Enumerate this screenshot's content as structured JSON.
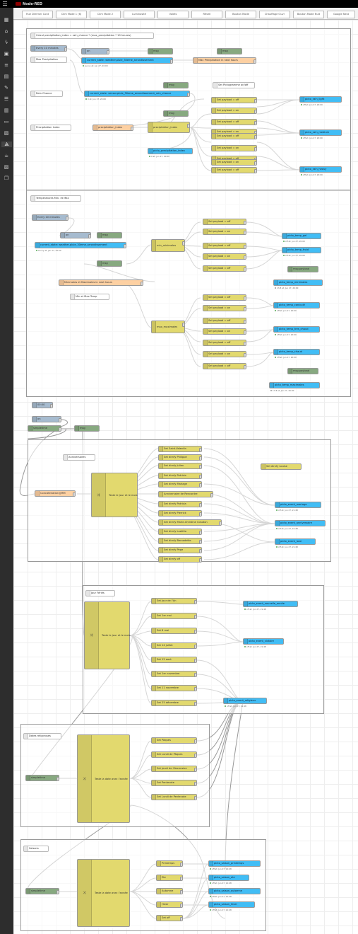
{
  "app": {
    "title": "Node-RED"
  },
  "tabs": [
    "Hue Dimmer Cont",
    "Clim Mode 1 (6)",
    "Clim Mode 2",
    "Luminosité",
    "Volets",
    "Réveil",
    "Bouton Mode",
    "Chauffage Ouvr",
    "Bouton Mode Nuit",
    "Google Nest"
  ],
  "sidebar": {
    "icons": [
      "grid-icon",
      "home-icon",
      "bolt-icon",
      "device-icon",
      "list-icon",
      "box-icon",
      "wrench-icon",
      "clipboard-icon",
      "calendar-icon",
      "window-icon",
      "chart-icon",
      "flow-icon",
      "cup-icon",
      "image-icon",
      "copy-icon"
    ]
  },
  "group1": {
    "comments": {
      "calc": "Calcul precipitation_index = rain_chance * (max_precipitation * 10 heures)",
      "max_precip": "Max Precipitation",
      "rain_chance": "Rain Chance",
      "precip_index": "Precipitation Index",
      "set_picto": "Set Pictogramme on/off"
    },
    "inject": "Every 10 minutes",
    "inject_on": "on",
    "debug_msg1": "msg",
    "debug_msg2": "msg",
    "debug_msg3": "msg",
    "debug_msg4": "msg",
    "ha_state1": "current_state: weather.pluie_30eme_arrondissement",
    "ha_state1_status": "sunny at: Jun 27, 20:00",
    "ha_state2": "current_state: sensor.pluie_30eme_arrondissement_rain_chance",
    "ha_state2_status": "0 at: Jun 27, 20:00",
    "func_max": "Max Precipitation in next hours",
    "func_index": "precipitation_index",
    "switch_index": "precipitation_index",
    "ha_index": "picto_precipitation_index",
    "ha_index_status": "0 at: Jun 27, 20:00",
    "changes": [
      "Set payload = off",
      "Set payload = on",
      "Set payload = off",
      "Set payload = on",
      "Set payload = off",
      "Set payload = on",
      "Set payload = off",
      "Set payload = on",
      "Set payload = off"
    ],
    "outputs": [
      {
        "label": "picto_rain_light",
        "status": "off at: Jun 27, 20:00"
      },
      {
        "label": "picto_rain_medium",
        "status": "off at: Jun 27, 20:00"
      },
      {
        "label": "picto_rain_heavy",
        "status": "off at: Jun 27, 20:00"
      }
    ]
  },
  "group2": {
    "comment_title": "Temperatures Min. et Max",
    "comment_minmax": "Min et Max Temp",
    "inject": "Every 10 minutes",
    "inject_on": "on",
    "debug_msg1": "msg",
    "debug_msg2": "msg",
    "debug_payload1": "msg.payload",
    "debug_payload2": "msg.payload",
    "ha_state": "current_state: weather.pluie_30eme_arrondissement",
    "ha_state_status": "sunny at: Jun 27, 20:00",
    "func": "Minimales et Maximales in next hours",
    "switch_min": "min_minimales",
    "switch_max": "max_maximales",
    "changes_min": [
      "Set payload = off",
      "Set payload = on",
      "Set payload = off",
      "Set payload = on",
      "Set payload = off"
    ],
    "changes_max": [
      "Set payload = off",
      "Set payload = on",
      "Set payload = off",
      "Set payload = on",
      "Set payload = off",
      "Set payload = on",
      "Set payload = off"
    ],
    "outputs": [
      {
        "label": "picto_temp_gel",
        "status": "off at: Jun 27, 20:00"
      },
      {
        "label": "picto_temp_froid",
        "status": "off at: Jun 27, 20:00"
      },
      {
        "label": "picto_temp_minimales",
        "status": "13.8 at: Jun 27, 20:00"
      },
      {
        "label": "picto_temp_caniculé",
        "status": "off at: Jun 27, 20:00"
      },
      {
        "label": "picto_temp_tres_chaud",
        "status": "off at: Jun 27, 20:00"
      },
      {
        "label": "picto_temp_chaud",
        "status": "off at: Jun 27, 20:00"
      },
      {
        "label": "picto_temp_maximales",
        "status": "17.8 at: Jun 27, 20:00"
      }
    ]
  },
  "standalone": {
    "inject_time": "00:00",
    "inject_on": "on",
    "simpletime": "simpletime",
    "debug_msg": "msg"
  },
  "group3": {
    "comment": "Anniversaires",
    "func": "Concatenation JJMM",
    "switch": "Teste le jour et le mois",
    "changes": [
      "Set Saint-Valentin",
      "Set dirnfy Philippe",
      "Set dirnfy Julien",
      "Set dirnfy Patricia",
      "Set dirnfy Mariage",
      "Anniversaire de Rencontre",
      "Set dirnfy Patricia",
      "Set dirnfy Pierrick",
      "Set dirnfy Marie-Christine Claudon",
      "Set dirnfy Laetitia",
      "Set dirnfy Bernadette",
      "Set dirnfy Pepe",
      "Set dirnfy off"
    ],
    "change_right": "Set dirnfy Louise",
    "outputs": [
      {
        "label": "picto_event_mariage",
        "status": "off at: Jun 27, 21:48"
      },
      {
        "label": "picto_event_anniversaire",
        "status": "off at: Jun 27, 21:48"
      },
      {
        "label": "picto_event_love",
        "status": "off at: Jun 27, 21:48"
      }
    ]
  },
  "group4": {
    "comment": "Jour Fériés",
    "switch": "Teste le jour et le mois",
    "changes": [
      "Set Jour de l'An",
      "Set 1er mai",
      "Set 8 mai",
      "Set 14 juillet",
      "Set 15 aout",
      "Set 1er novembre",
      "Set 11 novembre",
      "Set 25 décembre"
    ],
    "outputs": [
      {
        "label": "picto_event_nouvelle_année",
        "status": "off at: Jun 27, 21:48"
      },
      {
        "label": "picto_event_victoire",
        "status": "off at: Jun 27, 21:48"
      },
      {
        "label": "picto_event_religieux",
        "status": "off at: Jun 27, 21:48"
      }
    ]
  },
  "group5": {
    "comment": "Dates religieuses",
    "simpletime": "simpletime",
    "switch": "Teste la date avec l'année",
    "changes": [
      "Set Pâques",
      "Set Lundi de Pâques",
      "Set jeudi de l'Ascension",
      "Set Pentecote",
      "Set Lundi de Pentecote"
    ]
  },
  "group6": {
    "comment": "Saisons",
    "simpletime": "simpletime",
    "switch": "Teste la date avec l'année",
    "changes": [
      "Printemps",
      "Ete",
      "Automne",
      "Hiver",
      "Set off"
    ],
    "outputs": [
      {
        "label": "picto_saison_printemps",
        "status": "off at: Jun 27, 21:48"
      },
      {
        "label": "picto_saison_ete",
        "status": "off at: Jun 27, 21:48"
      },
      {
        "label": "picto_saison_automne",
        "status": "off at: Jun 27, 21:48"
      },
      {
        "label": "picto_saison_hiver",
        "status": "off at: Jun 27, 21:48"
      }
    ]
  }
}
